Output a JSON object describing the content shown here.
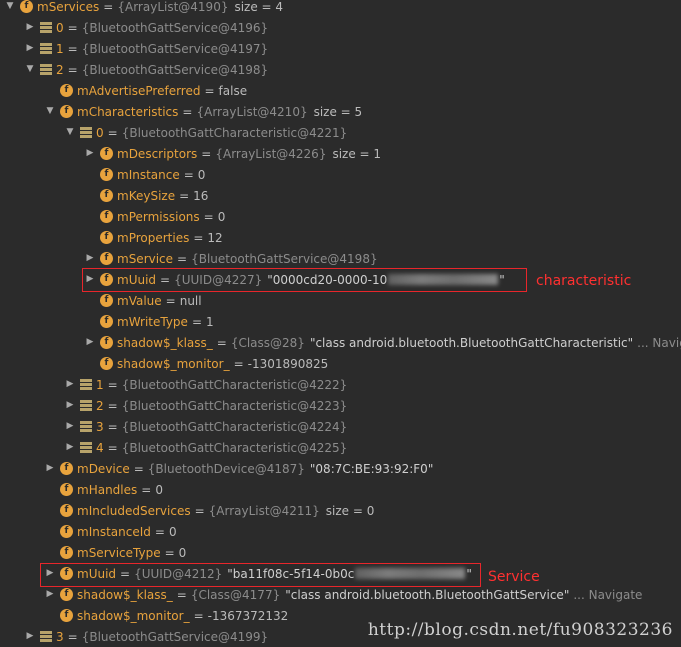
{
  "rows": [
    {
      "indent": 0,
      "arrow": "open",
      "icon": "field",
      "name": "mServices",
      "ref": "{ArrayList@4190}",
      "extra": "size = 4"
    },
    {
      "indent": 1,
      "arrow": "closed",
      "icon": "list",
      "name": "0",
      "ref": "{BluetoothGattService@4196}"
    },
    {
      "indent": 1,
      "arrow": "closed",
      "icon": "list",
      "name": "1",
      "ref": "{BluetoothGattService@4197}"
    },
    {
      "indent": 1,
      "arrow": "open",
      "icon": "list",
      "name": "2",
      "ref": "{BluetoothGattService@4198}"
    },
    {
      "indent": 2,
      "arrow": "none",
      "icon": "field",
      "name": "mAdvertisePreferred",
      "value": "false"
    },
    {
      "indent": 2,
      "arrow": "open",
      "icon": "field",
      "name": "mCharacteristics",
      "ref": "{ArrayList@4210}",
      "extra": "size = 5"
    },
    {
      "indent": 3,
      "arrow": "open",
      "icon": "list",
      "name": "0",
      "ref": "{BluetoothGattCharacteristic@4221}"
    },
    {
      "indent": 4,
      "arrow": "closed",
      "icon": "field",
      "name": "mDescriptors",
      "ref": "{ArrayList@4226}",
      "extra": "size = 1"
    },
    {
      "indent": 4,
      "arrow": "none",
      "icon": "field",
      "name": "mInstance",
      "value": "0"
    },
    {
      "indent": 4,
      "arrow": "none",
      "icon": "field",
      "name": "mKeySize",
      "value": "16"
    },
    {
      "indent": 4,
      "arrow": "none",
      "icon": "field",
      "name": "mPermissions",
      "value": "0"
    },
    {
      "indent": 4,
      "arrow": "none",
      "icon": "field",
      "name": "mProperties",
      "value": "12"
    },
    {
      "indent": 4,
      "arrow": "closed",
      "icon": "field",
      "name": "mService",
      "ref": "{BluetoothGattService@4198}"
    },
    {
      "indent": 4,
      "arrow": "closed",
      "icon": "field",
      "name": "mUuid",
      "ref": "{UUID@4227}",
      "str": "\"0000cd20-0000-10",
      "blurred": true,
      "str2": "\""
    },
    {
      "indent": 4,
      "arrow": "none",
      "icon": "field",
      "name": "mValue",
      "value": "null"
    },
    {
      "indent": 4,
      "arrow": "none",
      "icon": "field",
      "name": "mWriteType",
      "value": "1"
    },
    {
      "indent": 4,
      "arrow": "closed",
      "icon": "field",
      "name": "shadow$_klass_",
      "ref": "{Class@28}",
      "str": "\"class android.bluetooth.BluetoothGattCharacteristic\"",
      "nav": "... Navigate"
    },
    {
      "indent": 4,
      "arrow": "none",
      "icon": "field",
      "name": "shadow$_monitor_",
      "value": "-1301890825"
    },
    {
      "indent": 3,
      "arrow": "closed",
      "icon": "list",
      "name": "1",
      "ref": "{BluetoothGattCharacteristic@4222}"
    },
    {
      "indent": 3,
      "arrow": "closed",
      "icon": "list",
      "name": "2",
      "ref": "{BluetoothGattCharacteristic@4223}"
    },
    {
      "indent": 3,
      "arrow": "closed",
      "icon": "list",
      "name": "3",
      "ref": "{BluetoothGattCharacteristic@4224}"
    },
    {
      "indent": 3,
      "arrow": "closed",
      "icon": "list",
      "name": "4",
      "ref": "{BluetoothGattCharacteristic@4225}"
    },
    {
      "indent": 2,
      "arrow": "closed",
      "icon": "field",
      "name": "mDevice",
      "ref": "{BluetoothDevice@4187}",
      "str": "\"08:7C:BE:93:92:F0\""
    },
    {
      "indent": 2,
      "arrow": "none",
      "icon": "field",
      "name": "mHandles",
      "value": "0"
    },
    {
      "indent": 2,
      "arrow": "none",
      "icon": "field",
      "name": "mIncludedServices",
      "ref": "{ArrayList@4211}",
      "extra": "size = 0"
    },
    {
      "indent": 2,
      "arrow": "none",
      "icon": "field",
      "name": "mInstanceId",
      "value": "0"
    },
    {
      "indent": 2,
      "arrow": "none",
      "icon": "field",
      "name": "mServiceType",
      "value": "0"
    },
    {
      "indent": 2,
      "arrow": "closed",
      "icon": "field",
      "name": "mUuid",
      "ref": "{UUID@4212}",
      "str": "\"ba11f08c-5f14-0b0c",
      "blurred": true,
      "str2": "\""
    },
    {
      "indent": 2,
      "arrow": "closed",
      "icon": "field",
      "name": "shadow$_klass_",
      "ref": "{Class@4177}",
      "str": "\"class android.bluetooth.BluetoothGattService\"",
      "nav": "... Navigate"
    },
    {
      "indent": 2,
      "arrow": "none",
      "icon": "field",
      "name": "shadow$_monitor_",
      "value": "-1367372132"
    },
    {
      "indent": 1,
      "arrow": "closed",
      "icon": "list",
      "name": "3",
      "ref": "{BluetoothGattService@4199}"
    }
  ],
  "annotations": {
    "characteristic_label": "characteristic",
    "service_label": "Service"
  },
  "watermark": "http://blog.csdn.net/fu908323236",
  "colors": {
    "background": "#2b2b2b",
    "field_name": "#e8a33d",
    "highlight": "#e8262b"
  }
}
